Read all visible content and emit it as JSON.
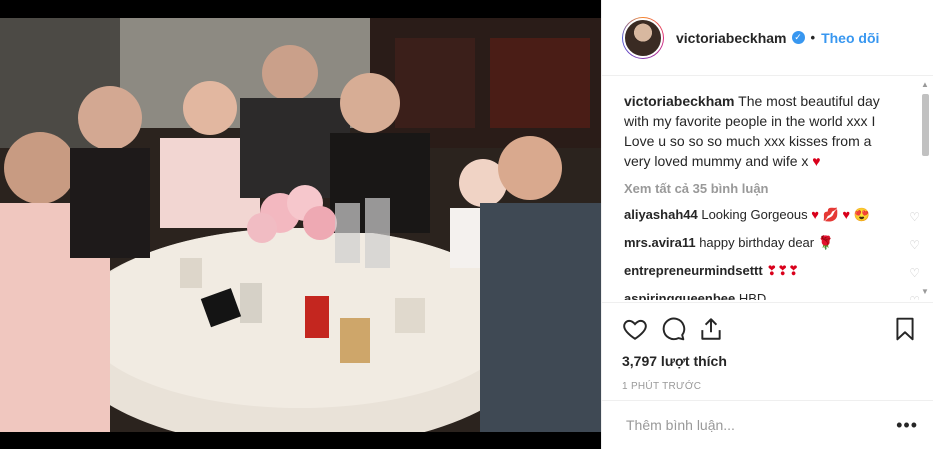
{
  "header": {
    "username": "victoriabeckham",
    "verified_icon": "verified-badge-icon",
    "separator": "•",
    "follow_label": "Theo dõi"
  },
  "caption": {
    "username": "victoriabeckham",
    "text": "The most beautiful day with my favorite people in the world xxx I Love u so so so much xxx kisses from a very loved mummy and wife x",
    "emoji": "♥"
  },
  "view_all_label": "Xem tất cả 35 bình luận",
  "comments": [
    {
      "user": "aliyashah44",
      "text": "Looking Gorgeous",
      "emoji": "♥ 💋 ♥ 😍"
    },
    {
      "user": "mrs.avira11",
      "text": "happy birthday dear",
      "emoji": "🌹"
    },
    {
      "user": "entrepreneurmindsettt",
      "text": "",
      "emoji": "❣❣❣"
    },
    {
      "user": "aspiringqueenbee",
      "text": "HBD",
      "emoji": ""
    }
  ],
  "actions": {
    "like_icon": "heart-icon",
    "comment_icon": "comment-icon",
    "share_icon": "share-icon",
    "save_icon": "bookmark-icon"
  },
  "likes_label": "3,797 lượt thích",
  "time_label": "1 PHÚT TRƯỚC",
  "add_comment_placeholder": "Thêm bình luận...",
  "more_label": "•••",
  "colors": {
    "accent": "#3897f0",
    "text": "#262626",
    "muted": "#999999",
    "divider": "#efefef"
  }
}
